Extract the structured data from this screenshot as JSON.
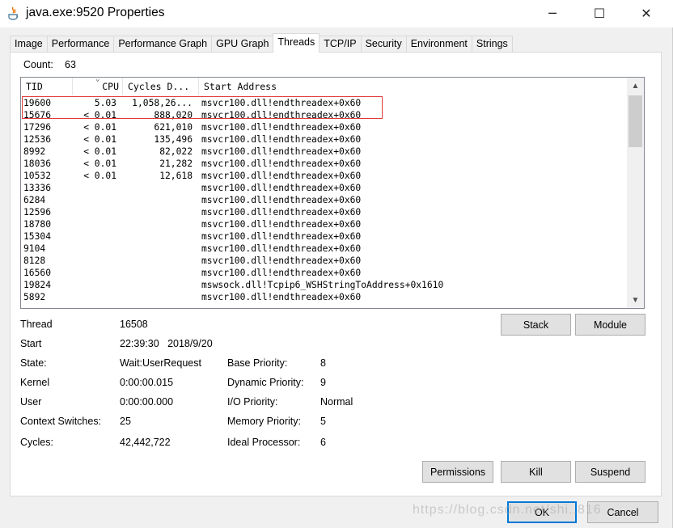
{
  "window": {
    "title": "java.exe:9520 Properties"
  },
  "titlebar": {
    "minimize_glyph": "─",
    "maximize_glyph": "☐",
    "close_glyph": "✕"
  },
  "tabs": [
    {
      "label": "Image"
    },
    {
      "label": "Performance"
    },
    {
      "label": "Performance Graph"
    },
    {
      "label": "GPU Graph"
    },
    {
      "label": "Threads",
      "active": true
    },
    {
      "label": "TCP/IP"
    },
    {
      "label": "Security"
    },
    {
      "label": "Environment"
    },
    {
      "label": "Strings"
    }
  ],
  "threads": {
    "count_label": "Count:",
    "count_value": "63",
    "columns": {
      "tid": "TID",
      "cpu": "CPU",
      "cycles": "Cycles D...",
      "start_address": "Start Address"
    },
    "rows": [
      {
        "tid": "19600",
        "cpu": "5.03",
        "cycles": "1,058,26...",
        "addr": "msvcr100.dll!endthreadex+0x60"
      },
      {
        "tid": "15676",
        "cpu": "< 0.01",
        "cycles": "888,020",
        "addr": "msvcr100.dll!endthreadex+0x60"
      },
      {
        "tid": "17296",
        "cpu": "< 0.01",
        "cycles": "621,010",
        "addr": "msvcr100.dll!endthreadex+0x60"
      },
      {
        "tid": "12536",
        "cpu": "< 0.01",
        "cycles": "135,496",
        "addr": "msvcr100.dll!endthreadex+0x60"
      },
      {
        "tid": "8992",
        "cpu": "< 0.01",
        "cycles": "82,022",
        "addr": "msvcr100.dll!endthreadex+0x60"
      },
      {
        "tid": "18036",
        "cpu": "< 0.01",
        "cycles": "21,282",
        "addr": "msvcr100.dll!endthreadex+0x60"
      },
      {
        "tid": "10532",
        "cpu": "< 0.01",
        "cycles": "12,618",
        "addr": "msvcr100.dll!endthreadex+0x60"
      },
      {
        "tid": "13336",
        "cpu": "",
        "cycles": "",
        "addr": "msvcr100.dll!endthreadex+0x60"
      },
      {
        "tid": "6284",
        "cpu": "",
        "cycles": "",
        "addr": "msvcr100.dll!endthreadex+0x60"
      },
      {
        "tid": "12596",
        "cpu": "",
        "cycles": "",
        "addr": "msvcr100.dll!endthreadex+0x60"
      },
      {
        "tid": "18780",
        "cpu": "",
        "cycles": "",
        "addr": "msvcr100.dll!endthreadex+0x60"
      },
      {
        "tid": "15304",
        "cpu": "",
        "cycles": "",
        "addr": "msvcr100.dll!endthreadex+0x60"
      },
      {
        "tid": "9104",
        "cpu": "",
        "cycles": "",
        "addr": "msvcr100.dll!endthreadex+0x60"
      },
      {
        "tid": "8128",
        "cpu": "",
        "cycles": "",
        "addr": "msvcr100.dll!endthreadex+0x60"
      },
      {
        "tid": "16560",
        "cpu": "",
        "cycles": "",
        "addr": "msvcr100.dll!endthreadex+0x60"
      },
      {
        "tid": "19824",
        "cpu": "",
        "cycles": "",
        "addr": "mswsock.dll!Tcpip6_WSHStringToAddress+0x1610"
      },
      {
        "tid": "5892",
        "cpu": "",
        "cycles": "",
        "addr": "msvcr100.dll!endthreadex+0x60"
      },
      {
        "tid": "",
        "cpu": "",
        "cycles": "",
        "addr": ""
      }
    ]
  },
  "details": {
    "thread_label": "Thread",
    "thread_value": "16508",
    "start_label": "Start",
    "start_value": "22:39:30   2018/9/20",
    "state_label": "State:",
    "state_value": "Wait:UserRequest",
    "kernel_label": "Kernel",
    "kernel_value": "0:00:00.015",
    "user_label": "User",
    "user_value": "0:00:00.000",
    "ctx_label": "Context Switches:",
    "ctx_value": "25",
    "cycles_label": "Cycles:",
    "cycles_value": "42,442,722",
    "base_priority_label": "Base Priority:",
    "base_priority_value": "8",
    "dynamic_priority_label": "Dynamic Priority:",
    "dynamic_priority_value": "9",
    "io_priority_label": "I/O Priority:",
    "io_priority_value": "Normal",
    "memory_priority_label": "Memory Priority:",
    "memory_priority_value": "5",
    "ideal_processor_label": "Ideal Processor:",
    "ideal_processor_value": "6"
  },
  "buttons": {
    "stack": "Stack",
    "module": "Module",
    "permissions": "Permissions",
    "kill": "Kill",
    "suspend": "Suspend",
    "ok": "OK",
    "cancel": "Cancel"
  },
  "watermark": "https://blog.csdn.net/shi..816"
}
